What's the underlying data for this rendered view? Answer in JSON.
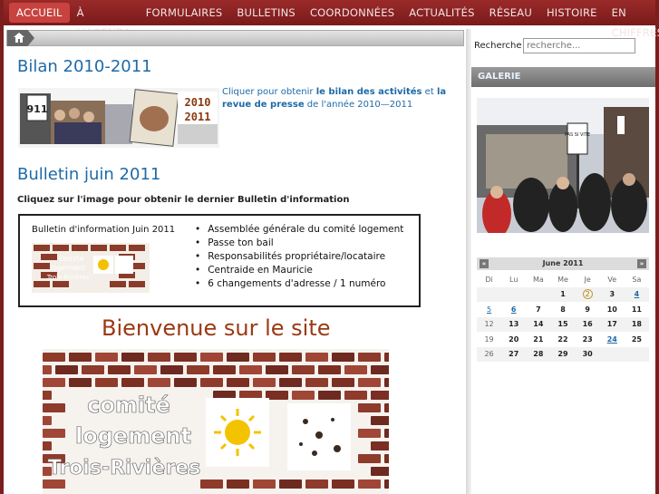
{
  "nav": {
    "items": [
      "ACCUEIL",
      "À L'AGENDA",
      "FORMULAIRES",
      "BULLETINS",
      "COORDONNÉES",
      "ACTUALITÉS",
      "RÉSEAU",
      "HISTOIRE",
      "EN CHIFFRES"
    ],
    "active": "ACCUEIL"
  },
  "breadcrumb": {
    "icon": "home-icon"
  },
  "main": {
    "bilan": {
      "title": "Bilan 2010-2011",
      "img_years_top": "2010",
      "img_years_bottom": "2011",
      "img_poster": "911",
      "text_prefix": "Cliquer pour obtenir ",
      "link1": "le bilan des activités",
      "text_mid": " et ",
      "link2": "la revue de presse",
      "text_suffix": " de l'année 2010—2011"
    },
    "bulletin": {
      "title": "Bulletin juin 2011",
      "note": "Cliquez sur l'image pour obtenir le dernier Bulletin d'information",
      "box_title": "Bulletin d'information Juin 2011",
      "items": [
        "Assemblée générale du comité logement",
        "Passe ton bail",
        "Responsabilités propriétaire/locataire",
        "Centraide en Mauricie",
        "6 changements d'adresse / 1 numéro"
      ],
      "logo_lines": [
        "comité",
        "logement",
        "Trois-Rivières"
      ]
    },
    "welcome": "Bienvenue sur le site",
    "wall_lines": [
      "comité",
      "logement",
      "Trois-Rivières"
    ]
  },
  "sidebar": {
    "search_label": "Recherche",
    "search_placeholder": "recherche...",
    "gallery_title": "GALERIE",
    "gallery_sign_text": "PAS SI VITE",
    "calendar": {
      "month": "June 2011",
      "prev": "«",
      "next": "»",
      "weekdays": [
        "Di",
        "Lu",
        "Ma",
        "Me",
        "Je",
        "Ve",
        "Sa"
      ],
      "weeks": [
        [
          "",
          "",
          "",
          "1",
          "2",
          "3",
          "4"
        ],
        [
          "5",
          "6",
          "7",
          "8",
          "9",
          "10",
          "11"
        ],
        [
          "12",
          "13",
          "14",
          "15",
          "16",
          "17",
          "18"
        ],
        [
          "19",
          "20",
          "21",
          "22",
          "23",
          "24",
          "25"
        ],
        [
          "26",
          "27",
          "28",
          "29",
          "30",
          "",
          ""
        ]
      ],
      "today": "2",
      "links": [
        "4",
        "5",
        "6",
        "24"
      ]
    }
  },
  "colors": {
    "nav_bg": "#8a2222",
    "nav_active": "#c8433f",
    "heading": "#1e6aa8",
    "welcome": "#9a3a12"
  }
}
